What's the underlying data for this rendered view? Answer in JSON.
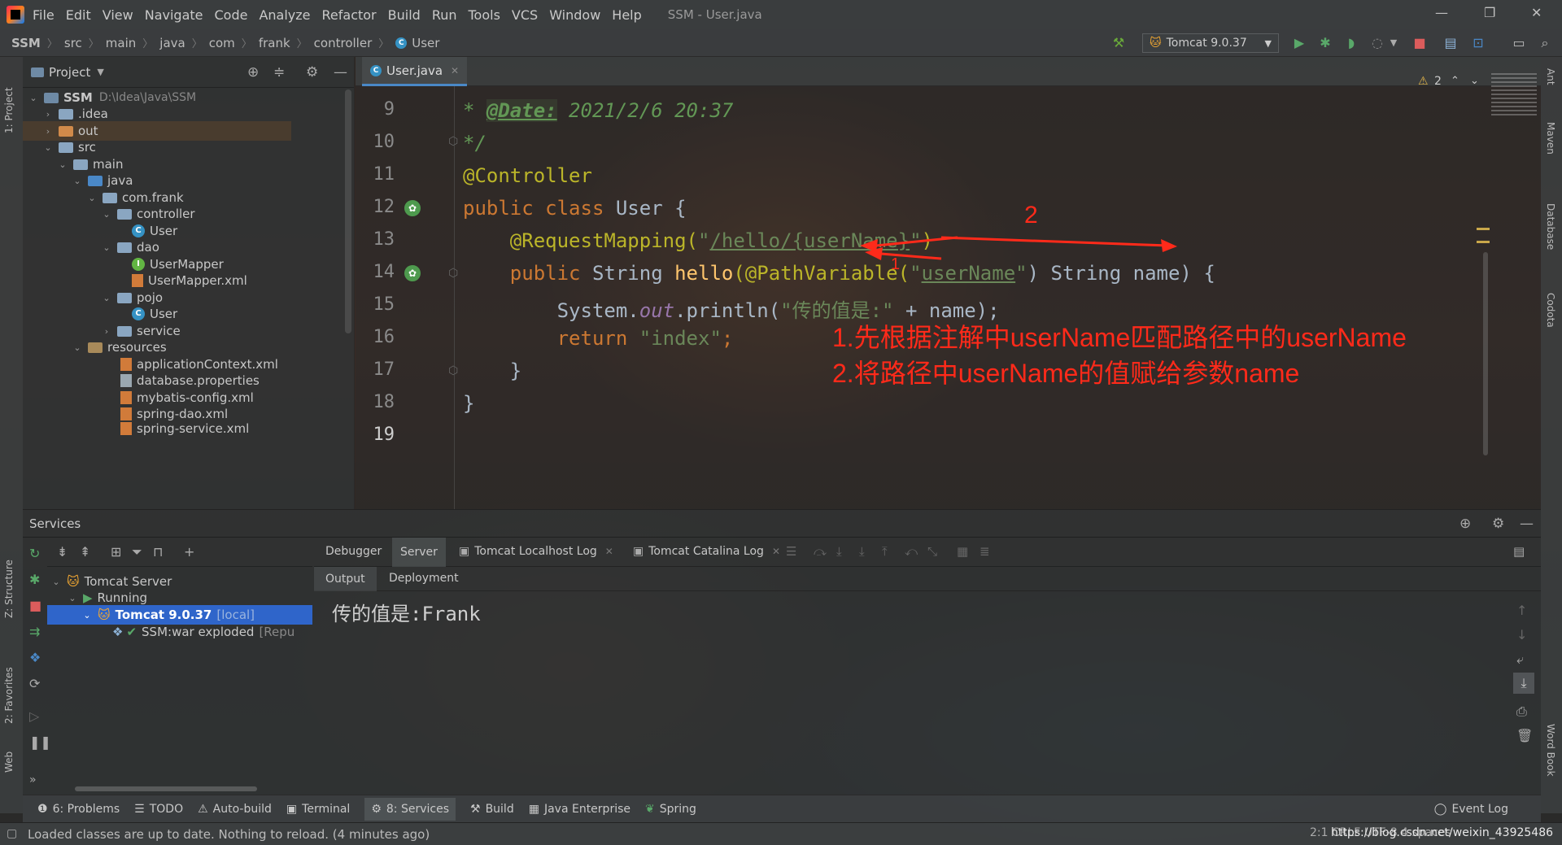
{
  "window": {
    "title": "SSM - User.java",
    "menu": [
      "File",
      "Edit",
      "View",
      "Navigate",
      "Code",
      "Analyze",
      "Refactor",
      "Build",
      "Run",
      "Tools",
      "VCS",
      "Window",
      "Help"
    ]
  },
  "breadcrumb": [
    "SSM",
    "src",
    "main",
    "java",
    "com",
    "frank",
    "controller",
    "User"
  ],
  "run_config": "Tomcat 9.0.37",
  "project_panel": {
    "title": "Project",
    "tree": [
      {
        "label": "SSM",
        "hint": "D:\\Idea\\Java\\SSM"
      },
      {
        "label": ".idea"
      },
      {
        "label": "out"
      },
      {
        "label": "src"
      },
      {
        "label": "main"
      },
      {
        "label": "java"
      },
      {
        "label": "com.frank"
      },
      {
        "label": "controller"
      },
      {
        "label": "User"
      },
      {
        "label": "dao"
      },
      {
        "label": "UserMapper"
      },
      {
        "label": "UserMapper.xml"
      },
      {
        "label": "pojo"
      },
      {
        "label": "User"
      },
      {
        "label": "service"
      },
      {
        "label": "resources"
      },
      {
        "label": "applicationContext.xml"
      },
      {
        "label": "database.properties"
      },
      {
        "label": "mybatis-config.xml"
      },
      {
        "label": "spring-dao.xml"
      },
      {
        "label": "spring-service.xml"
      }
    ]
  },
  "editor": {
    "tab": "User.java",
    "warnings": "2",
    "line_numbers": [
      "9",
      "10",
      "11",
      "12",
      "13",
      "14",
      "15",
      "16",
      "17",
      "18",
      "19"
    ],
    "code": {
      "l9_star": "* ",
      "l9_tag": "@Date:",
      "l9_rest": " 2021/2/6 20:37",
      "l10": "*/",
      "l11": "@Controller",
      "l12_kw": "public class",
      "l12_rest": " User {",
      "l13_ann": "@RequestMapping(",
      "l13_q1": "\"",
      "l13_str": "/hello/{userName}",
      "l13_q2": "\"",
      "l13_end": ")",
      "l14_kw": "public",
      "l14_type": " String ",
      "l14_fn": "hello",
      "l14_ann": "(@PathVariable(",
      "l14_q1": "\"",
      "l14_str": "userName",
      "l14_q2": "\"",
      "l14_rest": ") String name) {",
      "l15_a": "System.",
      "l15_fld": "out",
      "l15_b": ".println(",
      "l15_str": "\"传的值是:\"",
      "l15_c": " + name);",
      "l16_kw": "return",
      "l16_str": " \"index\"",
      "l16_end": ";",
      "l17": "}",
      "l18": "}"
    },
    "annotations": {
      "num2": "2",
      "num1": "1",
      "line1": "1.先根据注解中userName匹配路径中的userName",
      "line2": "2.将路径中userName的值赋给参数name"
    }
  },
  "services": {
    "title": "Services",
    "tree": {
      "server": "Tomcat Server",
      "running": "Running",
      "instance": "Tomcat 9.0.37",
      "instance_hint": "[local]",
      "artifact": "SSM:war exploded",
      "artifact_hint": "[Repu"
    },
    "tabs": [
      "Debugger",
      "Server",
      "Tomcat Localhost Log",
      "Tomcat Catalina Log"
    ],
    "subtabs": [
      "Output",
      "Deployment"
    ],
    "output": "传的值是:Frank"
  },
  "bottom_tabs": [
    "6: Problems",
    "TODO",
    "Auto-build",
    "Terminal",
    "8: Services",
    "Build",
    "Java Enterprise",
    "Spring"
  ],
  "event_log": "Event Log",
  "status": {
    "message": "Loaded classes are up to date. Nothing to reload. (4 minutes ago)",
    "right": "2:1  CRLF  UTF-8  4 spaces",
    "watermark": "https://blog.csdn.net/weixin_43925486"
  },
  "side_tabs": {
    "left": [
      "1: Project",
      "Z: Structure",
      "2: Favorites",
      "Web"
    ],
    "right": [
      "Ant",
      "Maven",
      "Database",
      "Codota",
      "Word Book"
    ]
  },
  "colors": {
    "annotation_red": "#ff2a1a",
    "keyword": "#cc7832",
    "string": "#6a8759",
    "annotation": "#bbb529",
    "selection": "#2f65ca"
  }
}
